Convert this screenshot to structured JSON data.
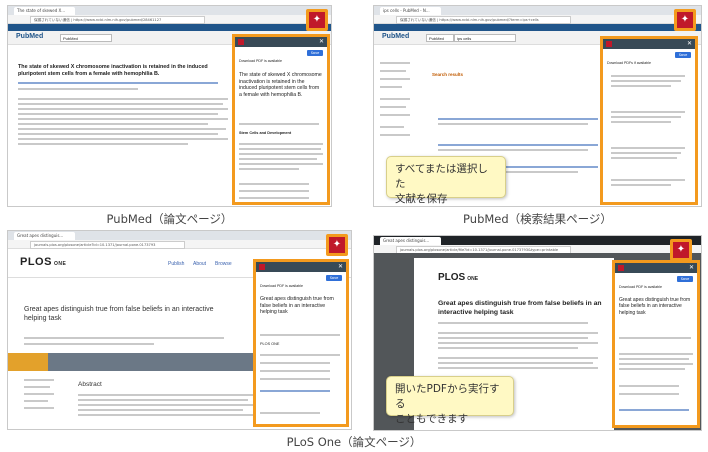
{
  "screens": {
    "pubmed_article": {
      "tab_title": "The state of skewed X...",
      "url": "保護されていない通信 | https://www.ncbi.nlm.nih.gov/pubmed/28461127",
      "logo": "PubMed",
      "search_db": "PubMed",
      "article_title": "The state of skewed X chromosome inactivation is retained in the induced pluripotent stem cells from a female with hemophilia B.",
      "panel": {
        "save_label": "Save",
        "download_note": "Download PDF is available",
        "title": "The state of skewed X chromosome inactivation is retained in the induced pluripotent stem cells from a female with hemophilia B.",
        "journal": "Stem Cells and Development"
      },
      "caption": "PubMed（論文ページ）"
    },
    "pubmed_search": {
      "tab_title": "ips cells - PubMed - N...",
      "url": "保護されていない通信 | https://www.ncbi.nlm.nih.gov/pubmed/?term=ips+cells",
      "logo": "PubMed",
      "search_db": "PubMed",
      "search_term": "ips cells",
      "results_label": "Search results",
      "panel": {
        "save_label": "Save",
        "download_note": "Download PDFs if available"
      },
      "callout": "すべてまたは選択した\n文献を保存",
      "caption": "PubMed（検索結果ページ）"
    },
    "plos_article": {
      "tab_title": "Great apes distinguis...",
      "url": "journals.plos.org/plosone/article?id=10.1371/journal.pone.0173793",
      "logo": "PLOS",
      "logo_sub": "ONE",
      "nav_publish": "Publish",
      "nav_about": "About",
      "nav_browse": "Browse",
      "article_title": "Great apes distinguish true from false beliefs in an interactive helping task",
      "abstract_label": "Abstract",
      "panel": {
        "save_label": "Save",
        "download_note": "Download PDF is available",
        "title": "Great apes distinguish true from false beliefs in an interactive helping task",
        "journal": "PLOS ONE"
      }
    },
    "plos_pdf": {
      "tab_title": "Great apes distinguis...",
      "url": "journals.plos.org/plosone/article/file?id=10.1371/journal.pone.0173793&type=printable",
      "logo": "PLOS",
      "logo_sub": "ONE",
      "article_title": "Great apes distinguish true from false beliefs in an interactive helping task",
      "panel": {
        "save_label": "Save",
        "download_note": "Download PDF is available",
        "title": "Great apes distinguish true from false beliefs in an interactive helping task"
      },
      "callout": "開いたPDFから実行する\nこともできます"
    }
  },
  "bottom_caption": "PLoS One（論文ページ）",
  "colors": {
    "highlight": "#f39a1e",
    "mendeley_red": "#c0182a",
    "callout_bg": "#fff9c4",
    "pubmed_blue": "#20558a",
    "plos_orange": "#e3a12b"
  },
  "icons": {
    "mendeley_button": "mendeley-icon",
    "close": "close-icon"
  }
}
